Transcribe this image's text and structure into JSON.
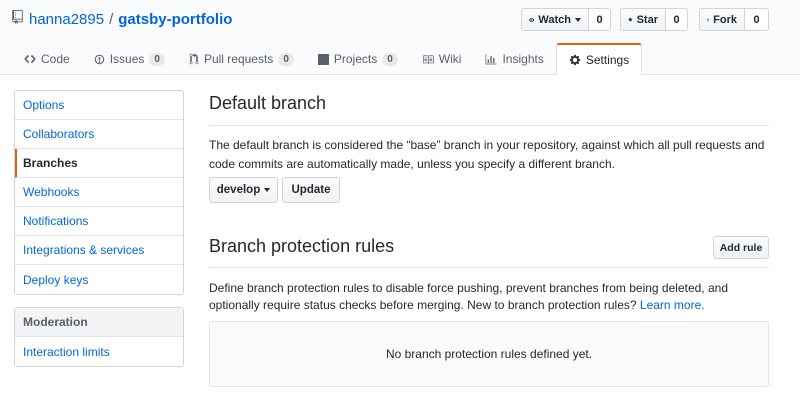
{
  "repo": {
    "owner": "hanna2895",
    "separator": "/",
    "name": "gatsby-portfolio"
  },
  "actions": [
    {
      "label": "Watch",
      "count": "0",
      "icon": "eye-icon"
    },
    {
      "label": "Star",
      "count": "0",
      "icon": "star-icon"
    },
    {
      "label": "Fork",
      "count": "0",
      "icon": "repo-forked-icon"
    }
  ],
  "tabs": [
    {
      "label": "Code",
      "icon": "code-icon"
    },
    {
      "label": "Issues",
      "count": "0",
      "icon": "issue-opened-icon"
    },
    {
      "label": "Pull requests",
      "count": "0",
      "icon": "git-pull-request-icon"
    },
    {
      "label": "Projects",
      "count": "0",
      "icon": "project-icon"
    },
    {
      "label": "Wiki",
      "icon": "book-icon"
    },
    {
      "label": "Insights",
      "icon": "graph-icon"
    },
    {
      "label": "Settings",
      "icon": "gear-icon",
      "selected": true
    }
  ],
  "menu": {
    "items": [
      "Options",
      "Collaborators",
      "Branches",
      "Webhooks",
      "Notifications",
      "Integrations & services",
      "Deploy keys"
    ],
    "selected": "Branches",
    "moderation_heading": "Moderation",
    "moderation_items": [
      "Interaction limits"
    ]
  },
  "default_branch": {
    "title": "Default branch",
    "description": "The default branch is considered the “base” branch in your repository, against which all pull requests and code commits are automatically made, unless you specify a different branch.",
    "branch": "develop",
    "update_label": "Update"
  },
  "protection": {
    "title": "Branch protection rules",
    "add_label": "Add rule",
    "description": "Define branch protection rules to disable force pushing, prevent branches from being deleted, and optionally require status checks before merging. New to branch protection rules?",
    "learn_more": "Learn more.",
    "empty": "No branch protection rules defined yet."
  },
  "colors": {
    "link": "#0366d6",
    "accent": "#e36209",
    "border": "#e1e4e8"
  }
}
